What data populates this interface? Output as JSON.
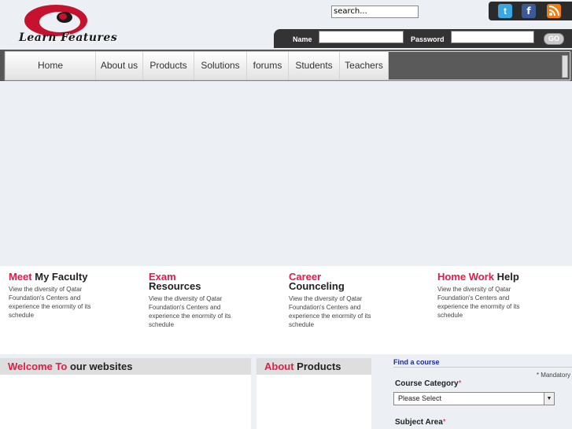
{
  "logo": {
    "text": "Learn Features"
  },
  "search": {
    "value": "search..."
  },
  "social": {
    "twitter": "t",
    "facebook": "f",
    "rss": "rss-icon"
  },
  "login": {
    "name_label": "Name",
    "password_label": "Password",
    "go_label": "GO"
  },
  "nav": {
    "items": [
      "Home",
      "About us",
      "Products",
      "Solutions",
      "forums",
      "Students",
      "Teachers"
    ]
  },
  "features": [
    {
      "hl": "Meet",
      "rest": " My Faculty",
      "text": "View the diversity of Qatar Foundation's Centers and experience the enormity of its schedule"
    },
    {
      "hl": "Exam",
      "rest": "Resources",
      "text": "View the diversity of Qatar Foundation's Centers and experience the enormity of its schedule"
    },
    {
      "hl": "Career",
      "rest": "Counceling",
      "text": "View the diversity of Qatar Foundation's Centers and experience the enormity of its schedule"
    },
    {
      "hl": "Home Work",
      "rest": " Help",
      "text": "View the diversity of Qatar Foundation's Centers and experience the enormity of its schedule"
    }
  ],
  "welcome": {
    "hl": "Welcome To",
    "rest": " our websites"
  },
  "about": {
    "hl": "About",
    "rest": " Products"
  },
  "find": {
    "title": "Find a course",
    "mandatory": "* Mandatory",
    "category_label": "Course Category",
    "category_value": "Please Select",
    "subject_label": "Subject Area",
    "star": "*"
  },
  "colors": {
    "accent": "#e31b48",
    "link": "#1a2a9c",
    "dark_bar": "#333333"
  }
}
